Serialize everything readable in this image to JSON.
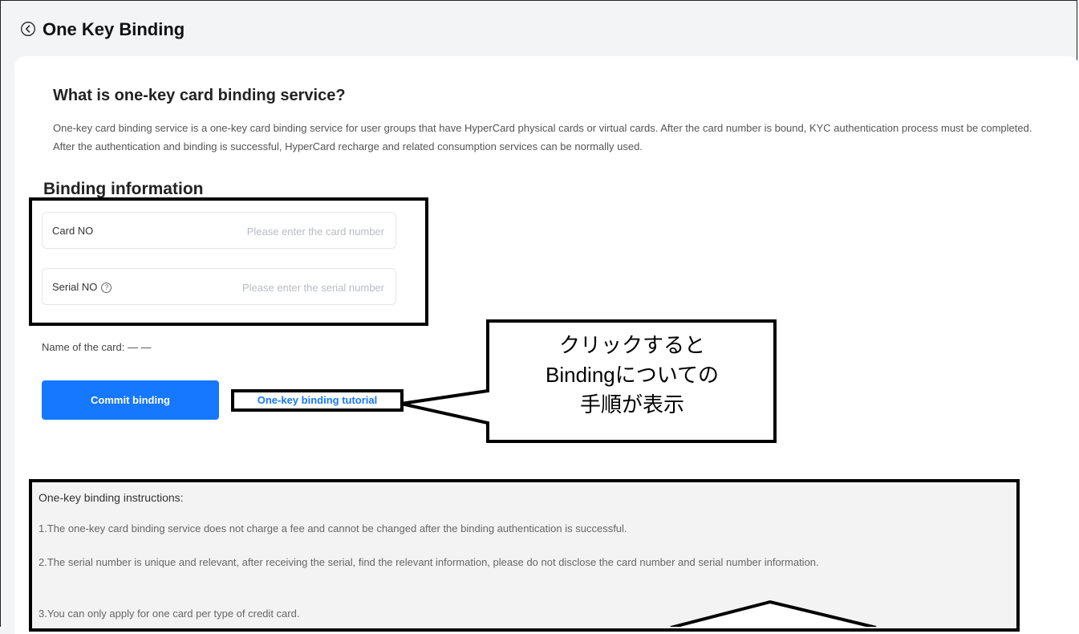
{
  "header": {
    "title": "One Key Binding"
  },
  "about": {
    "heading": "What is one-key card binding service?",
    "description": "One-key card binding service is a one-key card binding service for user groups that have HyperCard physical cards or virtual cards. After the card number is bound, KYC authentication process must be completed. After the authentication and binding is successful, HyperCard recharge and related consumption services can be normally used."
  },
  "binding": {
    "heading": "Binding information",
    "card_no_label": "Card NO",
    "card_no_placeholder": "Please enter the card number",
    "serial_no_label": "Serial NO",
    "serial_no_placeholder": "Please enter the serial number",
    "card_name": "Name of the card: — —",
    "commit_label": "Commit binding",
    "tutorial_label": "One-key binding tutorial"
  },
  "callout": {
    "line1": "クリックすると",
    "line2": "Bindingについての",
    "line3": "手順が表示"
  },
  "instructions": {
    "title": "One-key binding instructions:",
    "items": [
      "1.The one-key card binding service does not charge a fee and cannot be changed after the binding authentication is successful.",
      "2.The serial number is unique and relevant, after receiving the serial, find the relevant information, please do not disclose the card number and serial number information.",
      "3.You can only apply for one card per type of credit card."
    ]
  },
  "colors": {
    "primary": "#1677ff",
    "annotation": "#000000"
  }
}
